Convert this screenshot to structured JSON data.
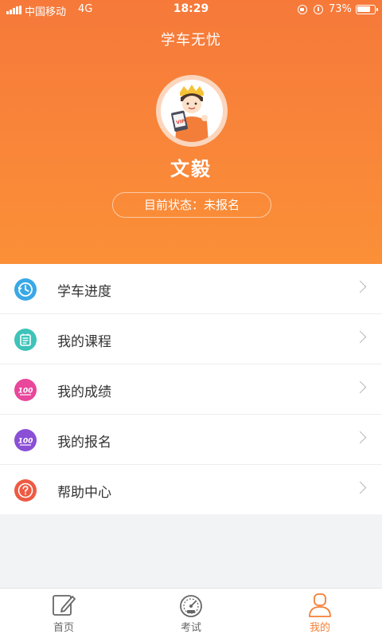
{
  "status_bar": {
    "carrier": "中国移动",
    "network": "4G",
    "time": "18:29",
    "battery_percent": "73%",
    "battery_level": 0.73,
    "icons": [
      "signal-icon",
      "orientation-lock-icon",
      "alarm-icon",
      "battery-icon"
    ]
  },
  "header": {
    "title": "学车无忧",
    "user_name": "文毅",
    "status_label": "目前状态：",
    "status_value": "未报名",
    "avatar_badge": "VIP"
  },
  "menu": {
    "items": [
      {
        "label": "学车进度",
        "icon": "clock-icon",
        "color": "#3aa8e6"
      },
      {
        "label": "我的课程",
        "icon": "notebook-icon",
        "color": "#3ec3b8"
      },
      {
        "label": "我的成绩",
        "icon": "score-100-icon",
        "color": "#e8479b",
        "badge": "100"
      },
      {
        "label": "我的报名",
        "icon": "score-100-icon",
        "color": "#8a4fd6",
        "badge": "100"
      },
      {
        "label": "帮助中心",
        "icon": "question-icon",
        "color": "#ee5a43"
      }
    ]
  },
  "tabbar": {
    "tabs": [
      {
        "label": "首页",
        "icon": "edit-icon",
        "active": false
      },
      {
        "label": "考试",
        "icon": "speedometer-icon",
        "active": false
      },
      {
        "label": "我的",
        "icon": "user-icon",
        "active": true
      }
    ]
  },
  "colors": {
    "brand_orange": "#f6793a",
    "tab_active": "#f47f36",
    "page_background": "#f2f3f5"
  }
}
